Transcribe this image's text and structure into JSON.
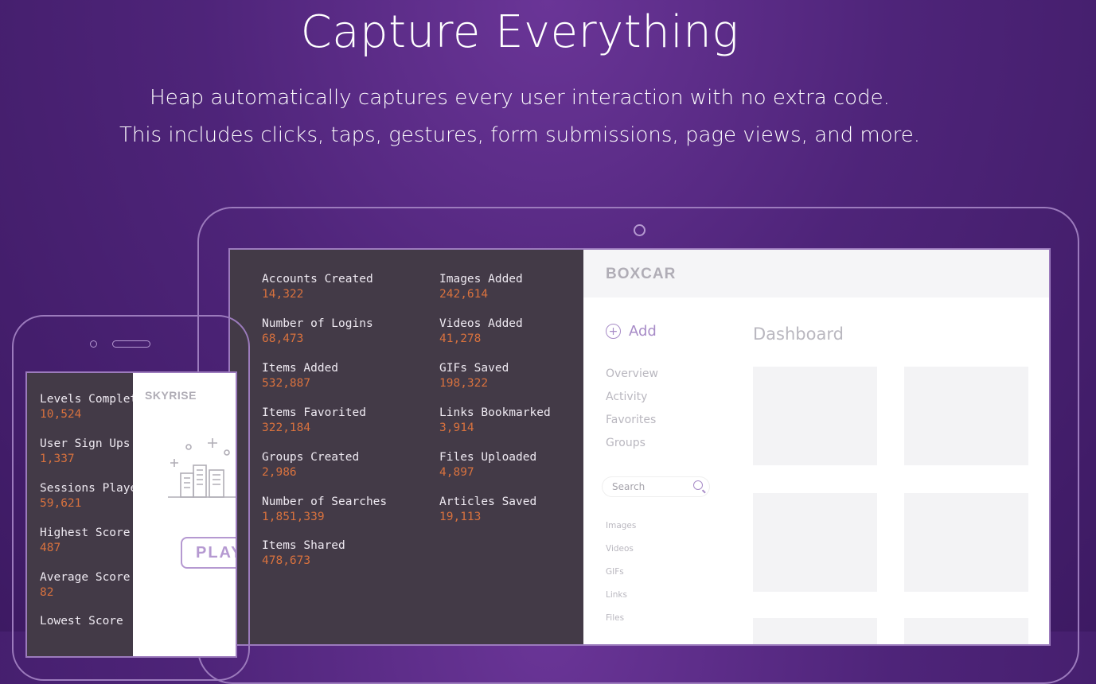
{
  "hero": {
    "title": "Capture Everything",
    "subtitle_line1": "Heap automatically captures every user interaction with no extra code.",
    "subtitle_line2": "This includes clicks, taps, gestures, form submissions, page views, and more."
  },
  "tablet": {
    "events_col1": [
      {
        "label": "Accounts Created",
        "value": "14,322"
      },
      {
        "label": "Number of Logins",
        "value": "68,473"
      },
      {
        "label": "Items Added",
        "value": "532,887"
      },
      {
        "label": "Items Favorited",
        "value": "322,184"
      },
      {
        "label": "Groups Created",
        "value": "2,986"
      },
      {
        "label": "Number of Searches",
        "value": "1,851,339"
      },
      {
        "label": "Items Shared",
        "value": "478,673"
      }
    ],
    "events_col2": [
      {
        "label": "Images Added",
        "value": "242,614"
      },
      {
        "label": "Videos Added",
        "value": "41,278"
      },
      {
        "label": "GIFs Saved",
        "value": "198,322"
      },
      {
        "label": "Links Bookmarked",
        "value": "3,914"
      },
      {
        "label": "Files Uploaded",
        "value": "4,897"
      },
      {
        "label": "Articles Saved",
        "value": "19,113"
      }
    ],
    "app": {
      "logo": "BOXCAR",
      "add_label": "Add",
      "nav": [
        "Overview",
        "Activity",
        "Favorites",
        "Groups"
      ],
      "search_placeholder": "Search",
      "sub_nav": [
        "Images",
        "Videos",
        "GIFs",
        "Links",
        "Files"
      ],
      "dashboard_title": "Dashboard"
    }
  },
  "phone": {
    "events": [
      {
        "label": "Levels Completed",
        "value": "10,524"
      },
      {
        "label": "User Sign Ups",
        "value": "1,337"
      },
      {
        "label": "Sessions Played",
        "value": "59,621"
      },
      {
        "label": "Highest Score",
        "value": "487"
      },
      {
        "label": "Average Score",
        "value": "82"
      },
      {
        "label": "Lowest Score",
        "value": ""
      }
    ],
    "app": {
      "logo": "SKYRISE",
      "play_label": "PLAY"
    }
  }
}
